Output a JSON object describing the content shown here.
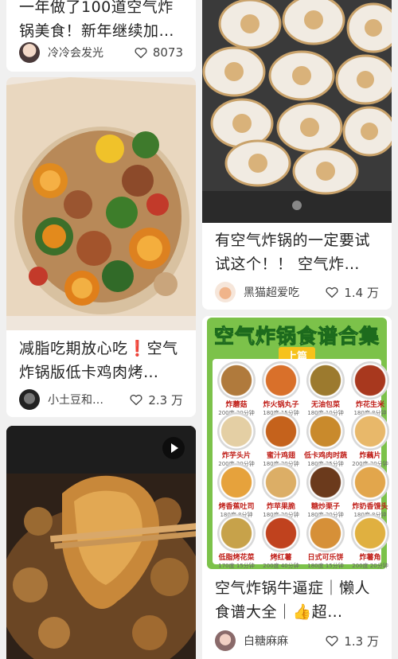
{
  "feed": {
    "cards": [
      {
        "title": "一年做了100道空气炸锅美食！新年继续加…",
        "author": "冷冷会发光",
        "likes": "8073"
      },
      {
        "title": "有空气炸锅的一定要试试这个！！ 空气炸…",
        "author": "黑猫超爱吃",
        "likes": "1.4 万"
      },
      {
        "title": "减脂吃期放心吃❗️空气炸锅版低卡鸡肉烤…",
        "author": "小土豆和…",
        "likes": "2.3 万"
      },
      {
        "title": "空气炸锅牛逼症｜懒人食谱大全｜👍超…",
        "author": "白糖麻麻",
        "likes": "1.3 万"
      }
    ],
    "poster": {
      "title": "空气炸锅食谱合集",
      "subtitle": "上篇",
      "items": [
        {
          "name": "炸蘑菇",
          "temp": "200度 20分钟",
          "color": "#b07a3c"
        },
        {
          "name": "炸火锅丸子",
          "temp": "180度 15分钟",
          "color": "#d9702a"
        },
        {
          "name": "无油包菜",
          "temp": "180度 10分钟",
          "color": "#9c7a2e"
        },
        {
          "name": "炸花生米",
          "temp": "180度 8分钟",
          "color": "#a8381e"
        },
        {
          "name": "炸芋头片",
          "temp": "200度 20分钟",
          "color": "#e4cfa4"
        },
        {
          "name": "蜜汁鸡翅",
          "temp": "180度 20分钟",
          "color": "#c5621c"
        },
        {
          "name": "低卡鸡肉时蔬",
          "temp": "180度 25分钟",
          "color": "#c98a2c"
        },
        {
          "name": "炸藕片",
          "temp": "200度 20分钟",
          "color": "#e8b86a"
        },
        {
          "name": "烤香蕉吐司",
          "temp": "180度 8分钟",
          "color": "#e6a23c"
        },
        {
          "name": "炸苹果脆",
          "temp": "180度 20分钟",
          "color": "#dcae66"
        },
        {
          "name": "糖炒栗子",
          "temp": "180度 20分钟",
          "color": "#6b3a1c"
        },
        {
          "name": "炸奶香馒头",
          "temp": "180度 8分钟",
          "color": "#e2a64c"
        },
        {
          "name": "低脂烤花菜",
          "temp": "170度 15分钟",
          "color": "#c7a24a"
        },
        {
          "name": "烤红薯",
          "temp": "200度 40分钟",
          "color": "#c0421e"
        },
        {
          "name": "日式可乐饼",
          "temp": "180度 15分钟",
          "color": "#d69038"
        },
        {
          "name": "炸薯角",
          "temp": "200度 20分钟",
          "color": "#e0b040"
        }
      ]
    },
    "colors": {
      "background": "#f0f0f0",
      "card": "#ffffff",
      "poster_green": "#7cc24a",
      "poster_yellow": "#f6c21b"
    }
  }
}
